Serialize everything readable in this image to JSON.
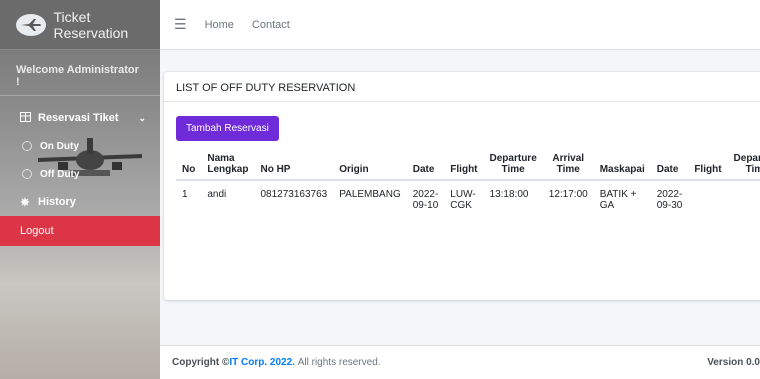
{
  "app": {
    "title": "Ticket Reservation"
  },
  "sidebar": {
    "welcome": "Welcome Administrator !",
    "menu": {
      "label": "Reservasi Tiket"
    },
    "sub_items": [
      {
        "label": "On Duty"
      },
      {
        "label": "Off Duty"
      }
    ],
    "history": {
      "label": "History"
    },
    "logout": {
      "label": "Logout"
    }
  },
  "topnav": {
    "home": "Home",
    "contact": "Contact"
  },
  "card": {
    "title": "LIST OF OFF DUTY RESERVATION",
    "add_button": "Tambah Reservasi",
    "headers": [
      "No",
      "Nama Lengkap",
      "No HP",
      "Origin",
      "Date",
      "Flight",
      "Departure Time",
      "Arrival Time",
      "Maskapai",
      "Date",
      "Flight",
      "Departure Time"
    ],
    "rows": [
      [
        "1",
        "andi",
        "081273163763",
        "PALEMBANG",
        "2022-09-10",
        "LUW-CGK",
        "13:18:00",
        "12:17:00",
        "BATIK + GA",
        "2022-09-30",
        "",
        ""
      ]
    ]
  },
  "footer": {
    "prefix": "Copyright ©",
    "company": "IT Corp. 2022.",
    "rights": "All rights reserved.",
    "version": "Version 0.0"
  },
  "colors": {
    "logout": "#dc3545",
    "button": "#6f2bd9",
    "link": "#007bff"
  }
}
